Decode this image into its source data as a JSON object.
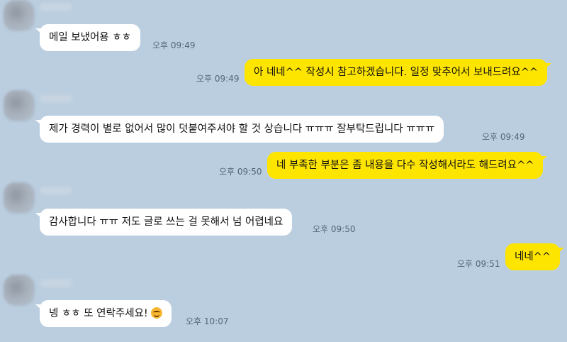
{
  "messages": [
    {
      "side": "in",
      "text": "메일 보냈어용 ㅎㅎ",
      "time": "오후 09:49"
    },
    {
      "side": "out",
      "text": "아 네네^^ 작성시 참고하겠습니다. 일정 맞추어서 보내드려요^^",
      "time": "오후 09:49"
    },
    {
      "side": "in",
      "text": "제가 경력이 별로 없어서 많이 덧붙여주셔야 할 것 상습니다 ㅠㅠㅠ 잘부탁드립니다 ㅠㅠㅠ",
      "time": "오후 09:49"
    },
    {
      "side": "out",
      "text": "네 부족한 부분은 좀 내용을 다수 작성해서라도 해드려요^^",
      "time": "오후 09:50"
    },
    {
      "side": "in",
      "text": "감사합니다 ㅠㅠ 저도 글로 쓰는 걸 못해서 넘 어렵네요",
      "time": "오후 09:50"
    },
    {
      "side": "out",
      "text": "네네^^",
      "time": "오후 09:51"
    },
    {
      "side": "in",
      "text": "넹 ㅎㅎ 또 연락주세요!",
      "time": "오후 10:07",
      "emoji": "smiling-face-emoji"
    }
  ]
}
